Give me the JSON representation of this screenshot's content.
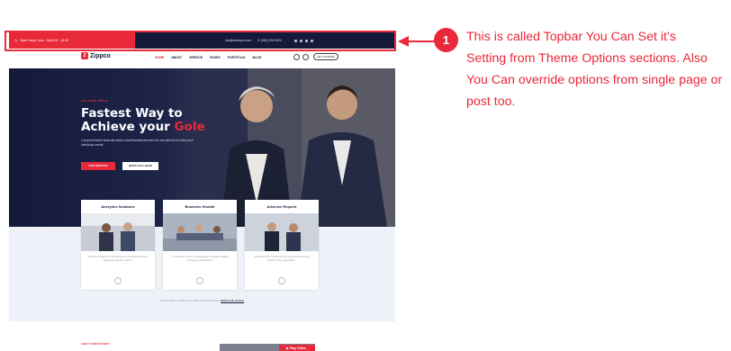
{
  "topbar": {
    "left_text": "Open Hours: Mon - Sat 8:00 - 18:00",
    "email_text": "info@example.com",
    "phone_text": "+1 (555) 000-0000",
    "social_icons": [
      "facebook-icon",
      "twitter-icon",
      "linkedin-icon",
      "instagram-icon"
    ]
  },
  "brand": {
    "name": "Zippco"
  },
  "menu": [
    "HOME",
    "ABOUT",
    "SERVICE",
    "PAGES",
    "PORTFOLIO",
    "BLOG"
  ],
  "nav_button": "GET STARTED",
  "hero": {
    "subtitle": "WELCOME ZIPPCO",
    "title_line1": "Fastest Way to",
    "title_line2_prefix": "Achieve your ",
    "title_highlight": "Gole",
    "description": "Comprehensive financial advice and financial services the are tailored to meet your individual needs.",
    "btn_primary": "OUR SERVICES",
    "btn_secondary": "QUICK CALL BACK"
  },
  "cards": [
    {
      "title": "Anerytics Solutions",
      "text": "We aim at integrity of the business as our business brand awareness and the revenue."
    },
    {
      "title": "Business Growth",
      "text": "To implement future oriented together strategic building company to all industries."
    },
    {
      "title": "Advence Reports",
      "text": "Connected with consulting firms at company financing growth of the organization."
    }
  ],
  "explore": {
    "prefix": "Don't hesitate, contact us for better help and services. ",
    "link": "Explore all services"
  },
  "about_tag": "ABOUT CONSULTANCY",
  "play_label": "Play Video",
  "annotation": {
    "badge": "1",
    "line1": "This is called Topbar You Can Set it’s",
    "line2": "Setting from Theme Options sections. Also",
    "line3": "You Can override options from single page or",
    "line4": "post too."
  },
  "colors": {
    "accent": "#e8293a",
    "navy": "#141a3a",
    "light_bg": "#eef2f8"
  }
}
